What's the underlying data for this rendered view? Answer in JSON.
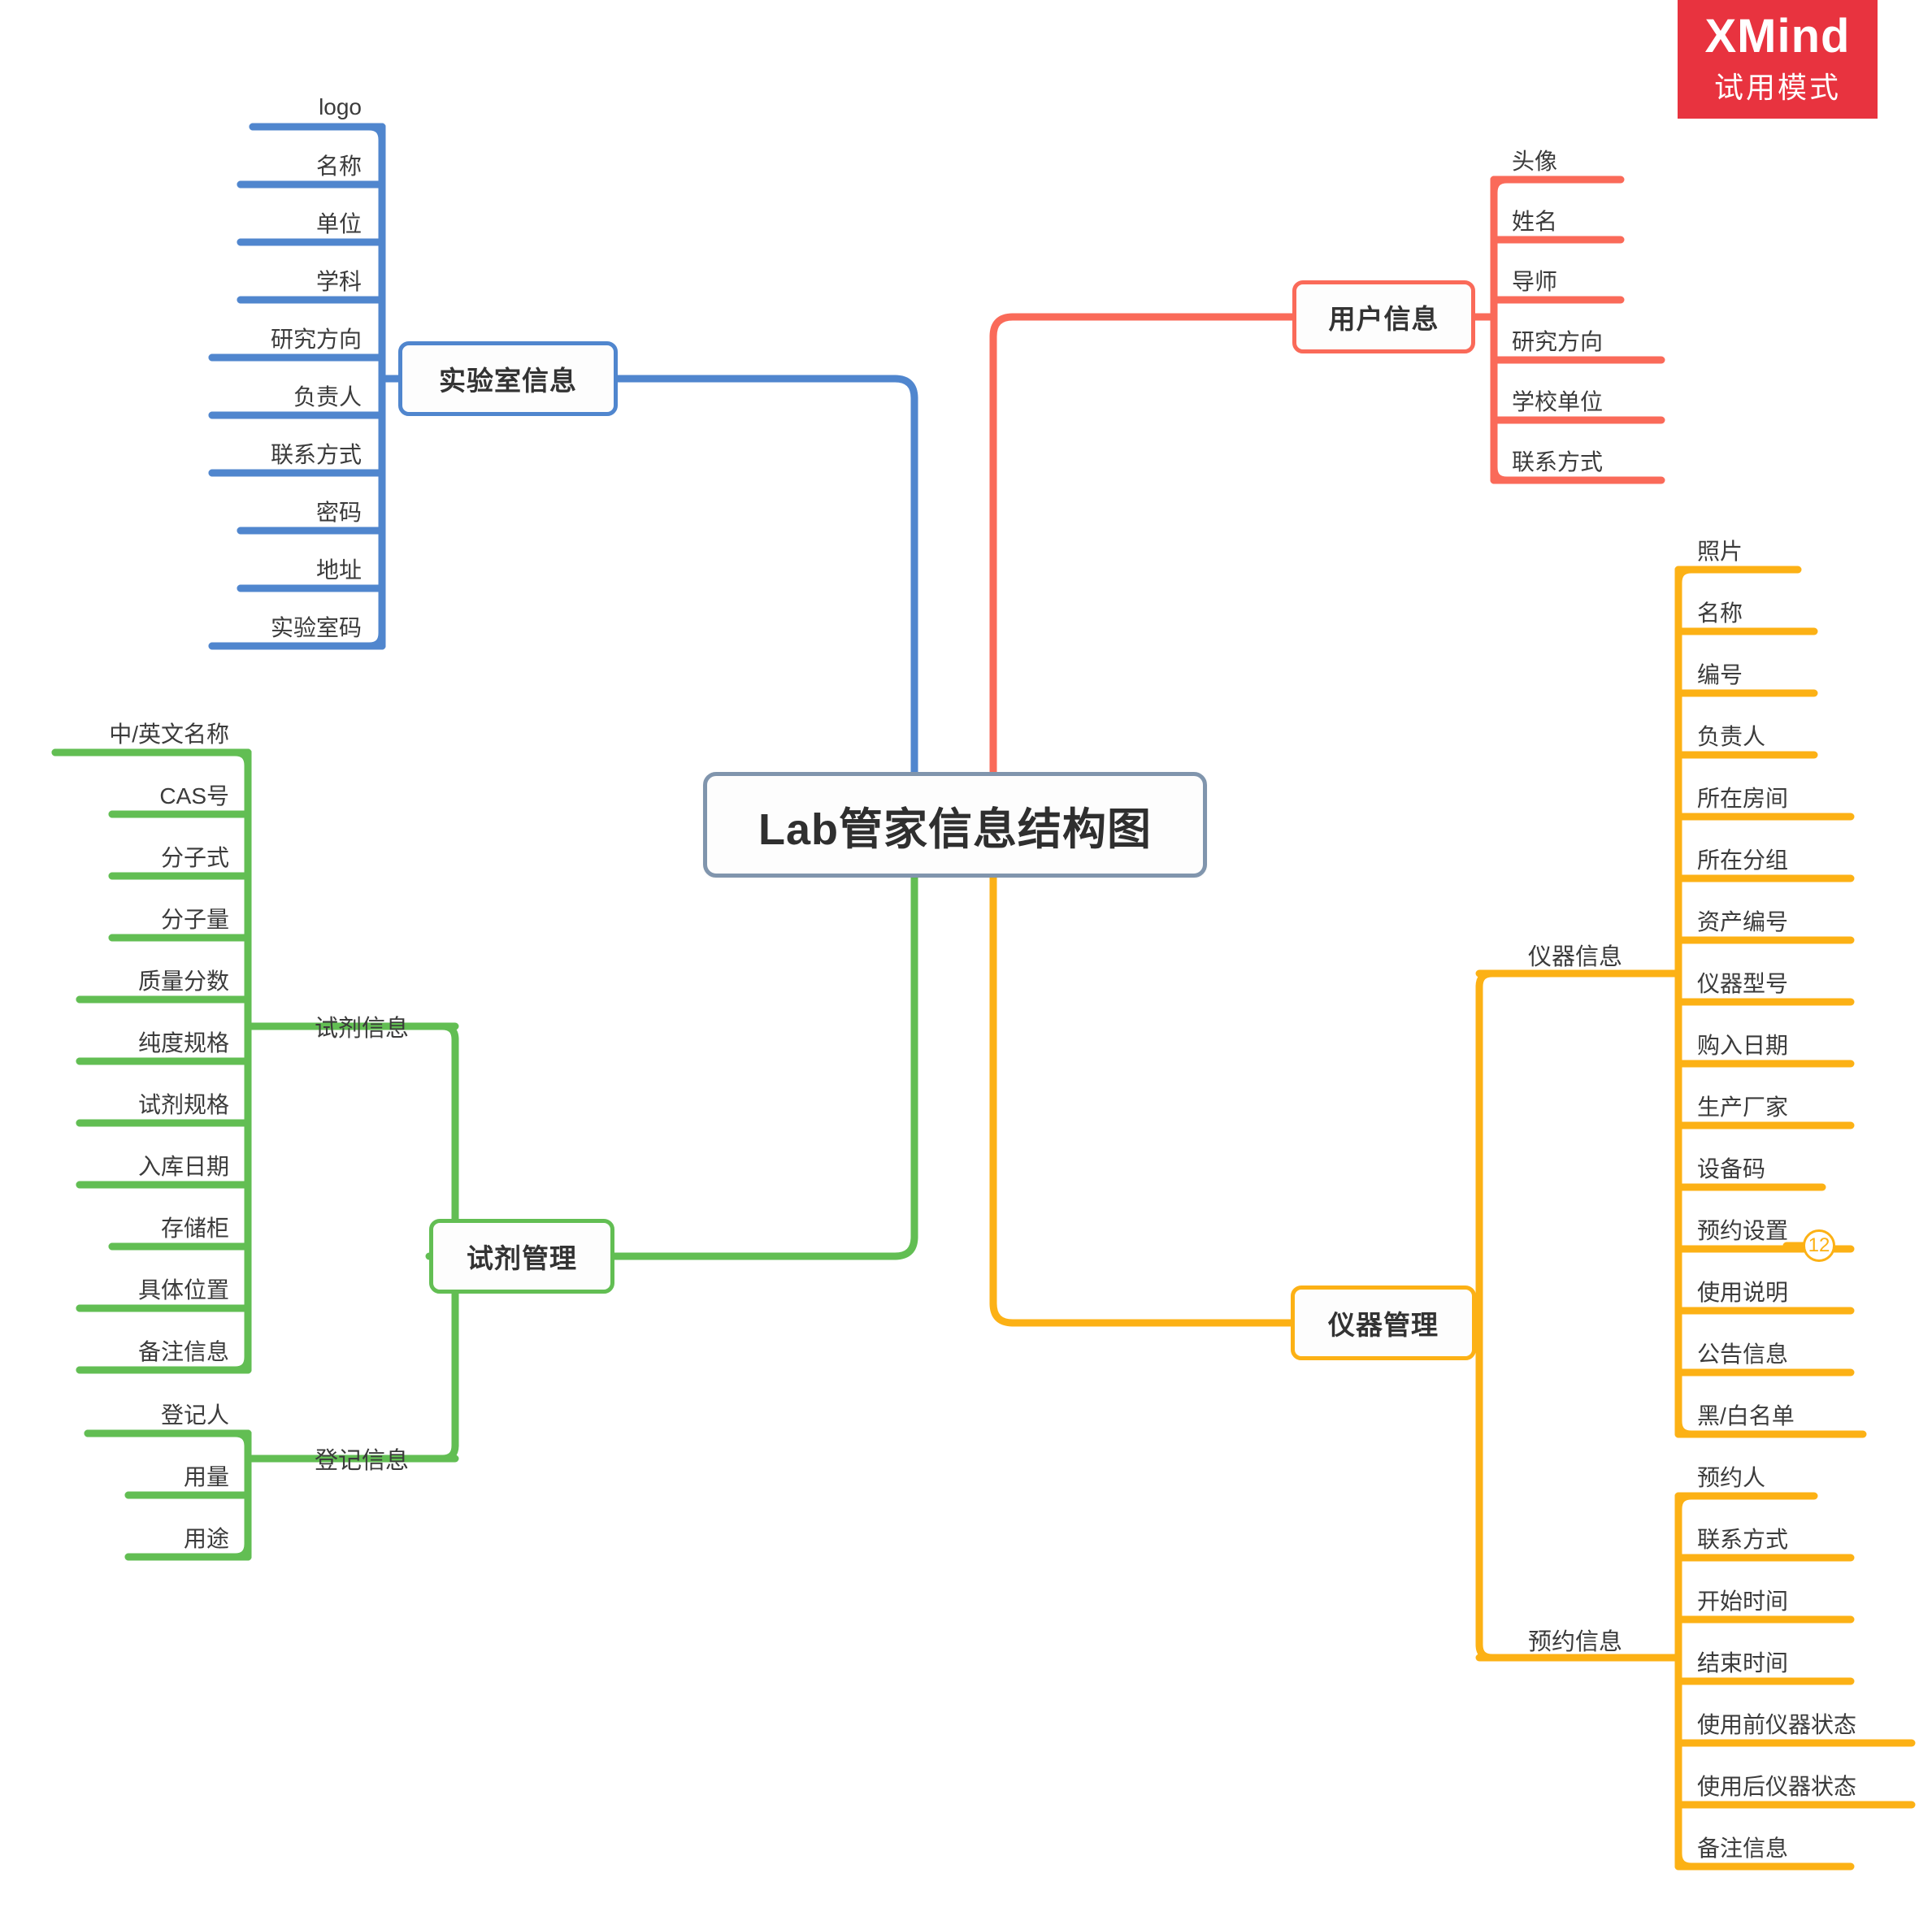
{
  "watermark": {
    "title": "XMind",
    "subtitle": "试用模式"
  },
  "root": {
    "label": "Lab管家信息结构图",
    "border_color": "#8095ad"
  },
  "colors": {
    "laboratory": "#5086ce",
    "user": "#fa6a59",
    "reagent": "#62be53",
    "instrument": "#fcb115",
    "root": "#8095ad"
  },
  "branches": [
    {
      "id": "laboratory",
      "label": "实验室信息",
      "color": "#5086ce",
      "side": "left",
      "leaves": [
        "logo",
        "名称",
        "单位",
        "学科",
        "研究方向",
        "负责人",
        "联系方式",
        "密码",
        "地址",
        "实验室码"
      ]
    },
    {
      "id": "user",
      "label": "用户信息",
      "color": "#fa6a59",
      "side": "right",
      "leaves": [
        "头像",
        "姓名",
        "导师",
        "研究方向",
        "学校单位",
        "联系方式"
      ]
    },
    {
      "id": "reagent",
      "label": "试剂管理",
      "color": "#62be53",
      "side": "left",
      "groups": [
        {
          "label": "试剂信息",
          "leaves": [
            "中/英文名称",
            "CAS号",
            "分子式",
            "分子量",
            "质量分数",
            "纯度规格",
            "试剂规格",
            "入库日期",
            "存储柜",
            "具体位置",
            "备注信息"
          ]
        },
        {
          "label": "登记信息",
          "leaves": [
            "登记人",
            "用量",
            "用途"
          ]
        }
      ]
    },
    {
      "id": "instrument",
      "label": "仪器管理",
      "color": "#fcb115",
      "side": "right",
      "groups": [
        {
          "label": "仪器信息",
          "leaves": [
            "照片",
            "名称",
            "编号",
            "负责人",
            "所在房间",
            "所在分组",
            "资产编号",
            "仪器型号",
            "购入日期",
            "生产厂家",
            "设备码",
            "预约设置",
            "使用说明",
            "公告信息",
            "黑/白名单"
          ]
        },
        {
          "label": "预约信息",
          "leaves": [
            "预约人",
            "联系方式",
            "开始时间",
            "结束时间",
            "使用前仪器状态",
            "使用后仪器状态",
            "备注信息"
          ]
        }
      ]
    }
  ],
  "badges": [
    {
      "text": "12",
      "attached_to": "预约设置",
      "color": "#fcb115"
    }
  ]
}
